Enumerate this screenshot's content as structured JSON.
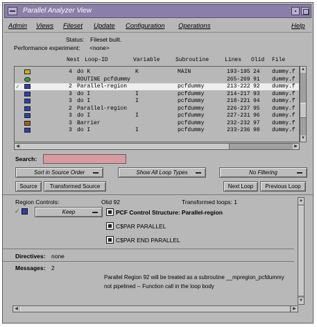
{
  "window": {
    "title": "Parallel Analyzer View"
  },
  "menu": {
    "admin": "Admin",
    "views": "Views",
    "fileset": "Fileset",
    "update": "Update",
    "configuration": "Configuration",
    "operations": "Operations",
    "help": "Help"
  },
  "status": {
    "label": "Status:",
    "value": "Fileset built."
  },
  "experiment": {
    "label": "Performance experiment:",
    "value": "<none>"
  },
  "list_headers": {
    "nest": "Nest",
    "loop_id": "Loop-ID",
    "variable": "Variable",
    "subroutine": "Subroutine",
    "lines": "Lines",
    "olid": "Olid",
    "file": "File"
  },
  "loops": [
    {
      "nest": "4",
      "loop": "do K",
      "variable": "K",
      "subroutine": "MAIN",
      "lines": "193-195",
      "olid": "24",
      "file": "dummy.f",
      "icon": "yellow-loop-icon"
    },
    {
      "nest": "",
      "loop": "ROUTINE pcfdummy",
      "variable": "",
      "subroutine": "",
      "lines": "265-269",
      "olid": "91",
      "file": "dummy.f",
      "icon": "green-routine-icon"
    },
    {
      "nest": "2",
      "loop": "Parallel-region",
      "variable": "",
      "subroutine": "pcfdummy",
      "lines": "213-222",
      "olid": "92",
      "file": "dummy.f",
      "icon": "blue-region-icon",
      "selected": true
    },
    {
      "nest": "3",
      "loop": "do I",
      "variable": "I",
      "subroutine": "pcfdummy",
      "lines": "214-217",
      "olid": "93",
      "file": "dummy.f",
      "icon": "blue-loop-icon"
    },
    {
      "nest": "3",
      "loop": "do I",
      "variable": "I",
      "subroutine": "pcfdummy",
      "lines": "218-221",
      "olid": "94",
      "file": "dummy.f",
      "icon": "blue-loop-icon"
    },
    {
      "nest": "2",
      "loop": "Parallel-region",
      "variable": "",
      "subroutine": "pcfdummy",
      "lines": "226-237",
      "olid": "95",
      "file": "dummy.f",
      "icon": "blue-region-icon"
    },
    {
      "nest": "3",
      "loop": "do I",
      "variable": "I",
      "subroutine": "pcfdummy",
      "lines": "227-231",
      "olid": "96",
      "file": "dummy.f",
      "icon": "blue-loop-icon"
    },
    {
      "nest": "3",
      "loop": "Barrier",
      "variable": "",
      "subroutine": "pcfdummy",
      "lines": "232-232",
      "olid": "97",
      "file": "dummy.f",
      "icon": "barrier-icon"
    },
    {
      "nest": "3",
      "loop": "do I",
      "variable": "I",
      "subroutine": "pcfdummy",
      "lines": "233-236",
      "olid": "98",
      "file": "dummy.f",
      "icon": "blue-loop-icon"
    }
  ],
  "search": {
    "label": "Search:",
    "value": ""
  },
  "options": {
    "sort": "Sort in Source Order",
    "types": "Show All Loop Types",
    "filter": "No Filtering"
  },
  "buttons": {
    "source": "Source",
    "transformed_source": "Transformed Source",
    "next_loop": "Next Loop",
    "previous_loop": "Previous Loop"
  },
  "region": {
    "label": "Region Controls:",
    "olid": "Olid 92",
    "transformed": "Transformed loops: 1",
    "keep": "Keep",
    "pcf_structure": "PCF Control Structure: Parallel-region",
    "cspar_parallel": "C$PAR PARALLEL",
    "cspar_end": "C$PAR END PARALLEL"
  },
  "directives": {
    "label": "Directives:",
    "value": "none"
  },
  "messages": {
    "label": "Messages:",
    "count": "2",
    "line1": "Parallel Region 92 will be treated as a subroutine __mpregion_pcfdummy",
    "line2": "not pipelined -- Function call in the loop body"
  }
}
